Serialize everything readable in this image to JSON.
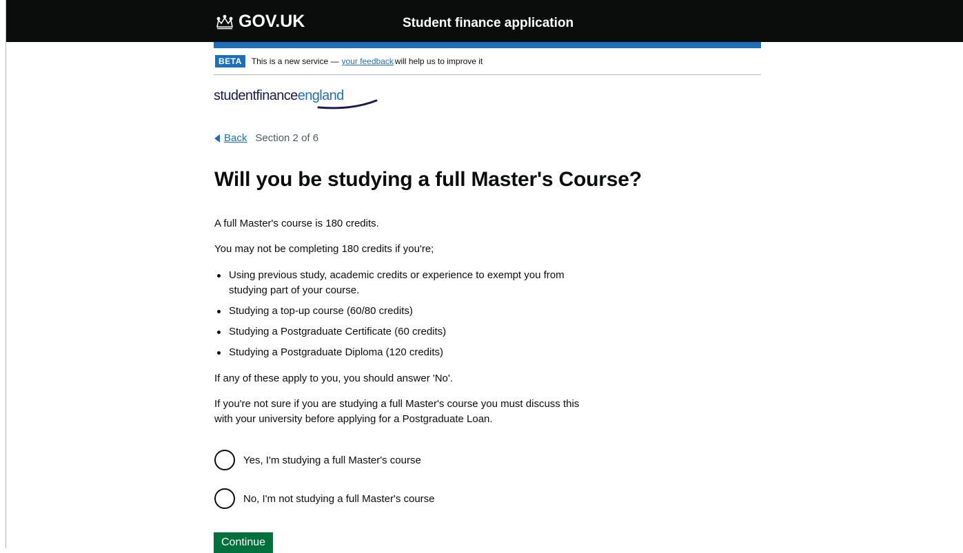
{
  "header": {
    "logo_text": "GOV.UK",
    "service_name": "Student finance application"
  },
  "beta_banner": {
    "tag": "BETA",
    "text_before": "This is a new service —",
    "link": "your feedback",
    "text_after": "will help us to improve it"
  },
  "brand": {
    "part1": "studentfinance",
    "part2": "england"
  },
  "nav": {
    "back_label": "Back",
    "section": "Section 2 of 6"
  },
  "main": {
    "heading": "Will you be studying a full Master's Course?",
    "intro": "A full Master's course is 180 credits.",
    "lead_in": "You may not be completing 180 credits if you're;",
    "bullets": [
      "Using previous study, academic credits or experience to exempt you from studying part of your course.",
      "Studying a top-up course (60/80 credits)",
      "Studying a Postgraduate Certificate (60 credits)",
      "Studying a Postgraduate Diploma (120 credits)"
    ],
    "apply_note": "If any of these apply to you, you should answer 'No'.",
    "unsure_note": "If you're not sure if you are studying a full Master's course you must discuss this with your university before applying for a Postgraduate Loan.",
    "options": [
      "Yes, I'm studying a full Master's course",
      "No, I'm not studying a full Master's course"
    ],
    "continue_label": "Continue"
  },
  "colors": {
    "header_bg": "#0b0c0c",
    "brand_blue": "#1d70b8",
    "button_green": "#00703c"
  }
}
